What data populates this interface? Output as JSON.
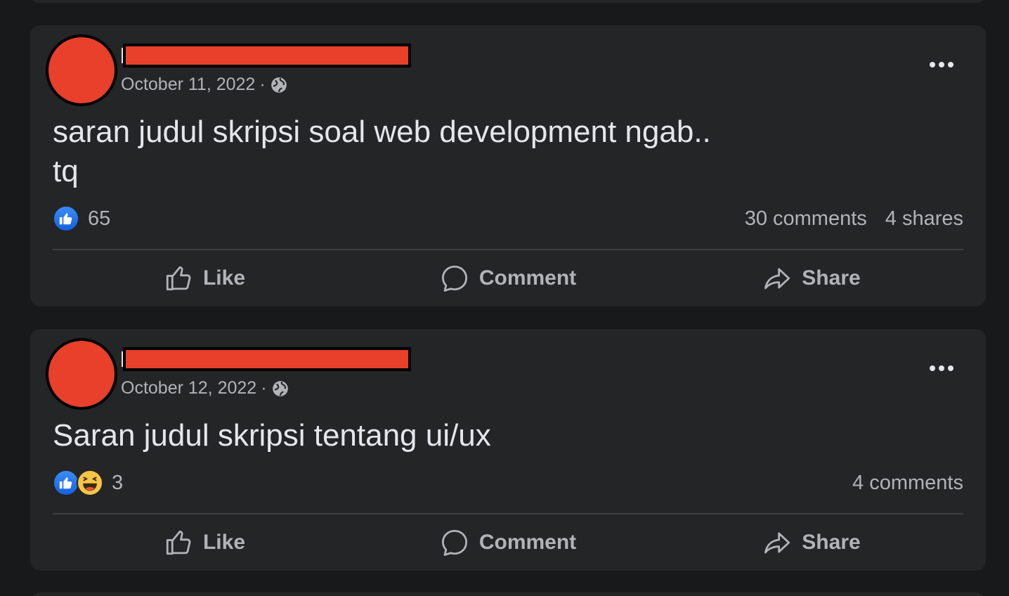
{
  "posts": [
    {
      "date": "October 11, 2022",
      "separator": "·",
      "text": "saran judul skripsi soal web development ngab..\ntq",
      "reaction_count": "65",
      "comments": "30 comments",
      "shares": "4 shares"
    },
    {
      "date": "October 12, 2022",
      "separator": "·",
      "text": "Saran judul skripsi tentang ui/ux",
      "reaction_count": "3",
      "comments": "4 comments"
    }
  ],
  "actions": {
    "like": "Like",
    "comment": "Comment",
    "share": "Share"
  },
  "icons": {
    "audience": "globe-icon",
    "menu": "more-icon",
    "like": "thumbs-up-icon",
    "comment": "speech-bubble-icon",
    "share": "share-arrow-icon"
  },
  "colors": {
    "background": "#18191a",
    "card": "#242526",
    "redaction": "#e8402a",
    "like_blue": "#1877f2"
  }
}
